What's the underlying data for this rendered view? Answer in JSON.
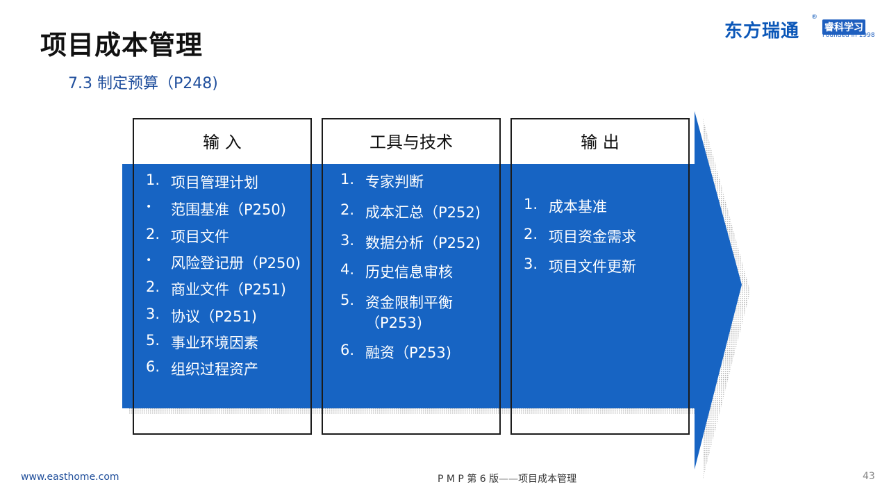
{
  "header": {
    "title": "项目成本管理",
    "subtitle": "7.3 制定预算（P248)",
    "logo_text": "东方瑞通",
    "logo_registered": "®",
    "logo_tag": "睿科学习",
    "logo_founded": "Founded in 1998"
  },
  "columns": [
    {
      "heading": "输 入",
      "items": [
        {
          "num": "1.",
          "text": "项目管理计划"
        },
        {
          "num": "•",
          "text": "范围基准（P250)"
        },
        {
          "num": "2.",
          "text": "项目文件"
        },
        {
          "num": "•",
          "text": "风险登记册（P250)"
        },
        {
          "num": "2.",
          "text": "商业文件（P251)"
        },
        {
          "num": "3.",
          "text": "协议（P251)"
        },
        {
          "num": "5.",
          "text": "事业环境因素"
        },
        {
          "num": "6.",
          "text": "组织过程资产"
        }
      ]
    },
    {
      "heading": "工具与技术",
      "items": [
        {
          "num": "1.",
          "text": "专家判断"
        },
        {
          "num": "2.",
          "text": "成本汇总（P252)"
        },
        {
          "num": "3.",
          "text": "数据分析（P252)"
        },
        {
          "num": "4.",
          "text": "历史信息审核"
        },
        {
          "num": "5.",
          "text": "资金限制平衡"
        },
        {
          "num": "",
          "text": "（P253)"
        },
        {
          "num": "6.",
          "text": "融资（P253)"
        }
      ]
    },
    {
      "heading": "输 出",
      "items": [
        {
          "num": "1.",
          "text": "成本基准"
        },
        {
          "num": "2.",
          "text": "项目资金需求"
        },
        {
          "num": "3.",
          "text": "项目文件更新"
        }
      ]
    }
  ],
  "footer": {
    "website": "www.easthome.com",
    "course": "P M P 第 6 版",
    "dash": "——",
    "course_topic": "项目成本管理",
    "page_number": "43"
  },
  "colors": {
    "panel_blue": "#1764c3",
    "title_blue": "#1f4e9c"
  }
}
